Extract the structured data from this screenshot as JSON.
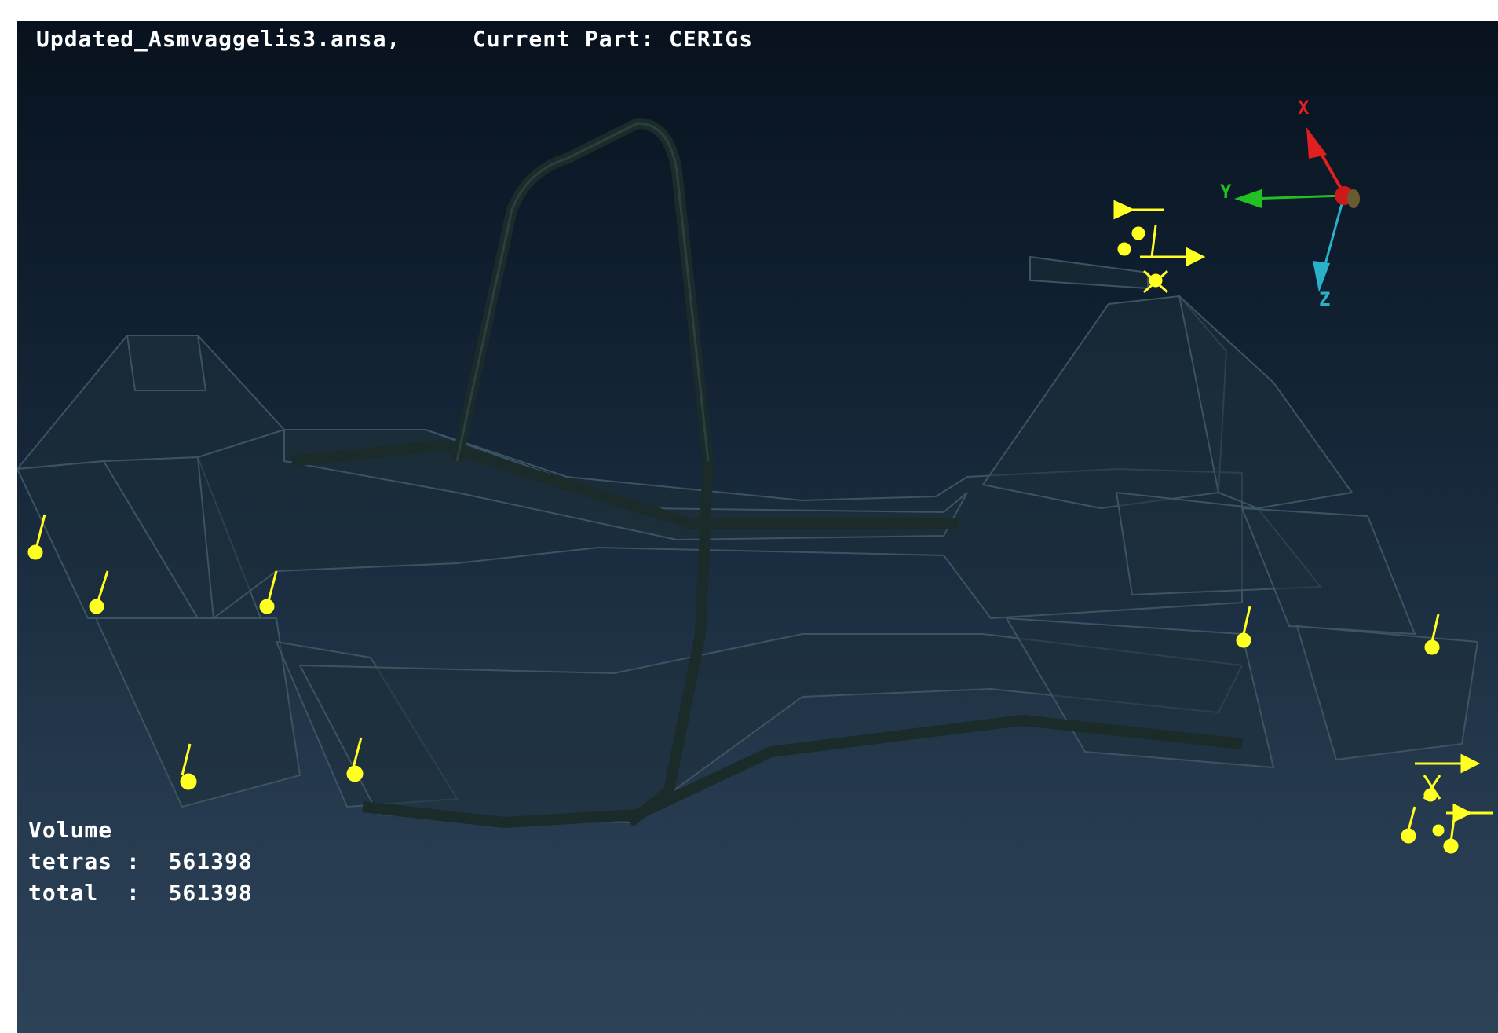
{
  "window": {
    "file_name": "Updated_Asmvaggelis3.ansa,",
    "current_part": "Current Part: CERIGs"
  },
  "stats": {
    "heading": "Volume",
    "tetras_label": "tetras :",
    "tetras_value": "561398",
    "total_label": "total  :",
    "total_value": "561398"
  },
  "axes": {
    "x_label": "X",
    "y_label": "Y",
    "z_label": "Z",
    "x_color": "#e02020",
    "y_color": "#22c022",
    "z_color": "#2ab0c8"
  },
  "colors": {
    "background_top": "#08121e",
    "background_bottom": "#2c4256",
    "boundary_condition": "#ffff22",
    "mesh_edge": "#3c5462",
    "tube": "#1a2b29"
  },
  "icons": {
    "axis_triad": "xyz-triad-icon",
    "constraint_arrow": "yellow-arrow-icon"
  }
}
